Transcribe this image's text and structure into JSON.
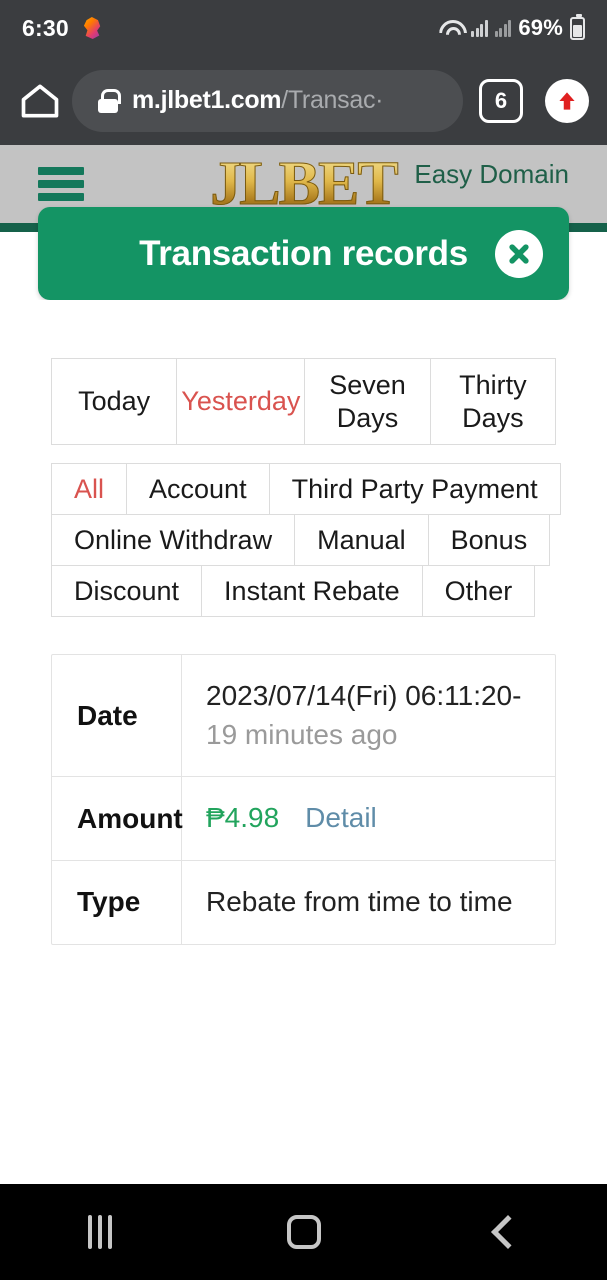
{
  "status_bar": {
    "clock": "6:30",
    "app_icon": "snapchat-icon",
    "wifi_icon": "wifi-icon",
    "signal_icon": "signal-bars-icon",
    "battery_percent": "69%",
    "battery_icon": "battery-icon"
  },
  "browser": {
    "home_icon": "home-icon",
    "lock_icon": "lock-icon",
    "url_domain": "m.jlbet1.com",
    "url_path": "/Transac·",
    "tab_count": "6",
    "upload_icon": "up-arrow-icon"
  },
  "site_header": {
    "menu_icon": "hamburger-menu-icon",
    "logo_text": "JLBET",
    "easy_domain_link": "Easy Domain"
  },
  "modal": {
    "title": "Transaction records",
    "close_icon": "close-icon",
    "accent_green": "#149464"
  },
  "filters": {
    "period_tabs": [
      {
        "label": "Today",
        "active": false
      },
      {
        "label": "Yesterday",
        "active": true
      },
      {
        "label": "Seven Days",
        "active": false
      },
      {
        "label": "Thirty Days",
        "active": false
      }
    ],
    "category_rows": [
      [
        {
          "label": "All",
          "active": true
        },
        {
          "label": "Account",
          "active": false
        },
        {
          "label": "Third Party Payment",
          "active": false
        }
      ],
      [
        {
          "label": "Online Withdraw",
          "active": false
        },
        {
          "label": "Manual",
          "active": false
        },
        {
          "label": "Bonus",
          "active": false
        }
      ],
      [
        {
          "label": "Discount",
          "active": false
        },
        {
          "label": "Instant Rebate",
          "active": false
        },
        {
          "label": "Other",
          "active": false
        }
      ]
    ],
    "active_color": "#d9534f"
  },
  "record": {
    "date_label": "Date",
    "date_value": "2023/07/14(Fri) 06:11:20-",
    "date_relative": " 19 minutes ago",
    "amount_label": "Amount",
    "amount_value": "₱4.98",
    "detail_link": "Detail",
    "type_label": "Type",
    "type_value": "Rebate from time to time",
    "amount_color": "#22a45d",
    "link_color": "#5f8ca8"
  },
  "nav_bar": {
    "recent_icon": "recent-apps-icon",
    "home_icon": "home-button-icon",
    "back_icon": "back-button-icon"
  }
}
